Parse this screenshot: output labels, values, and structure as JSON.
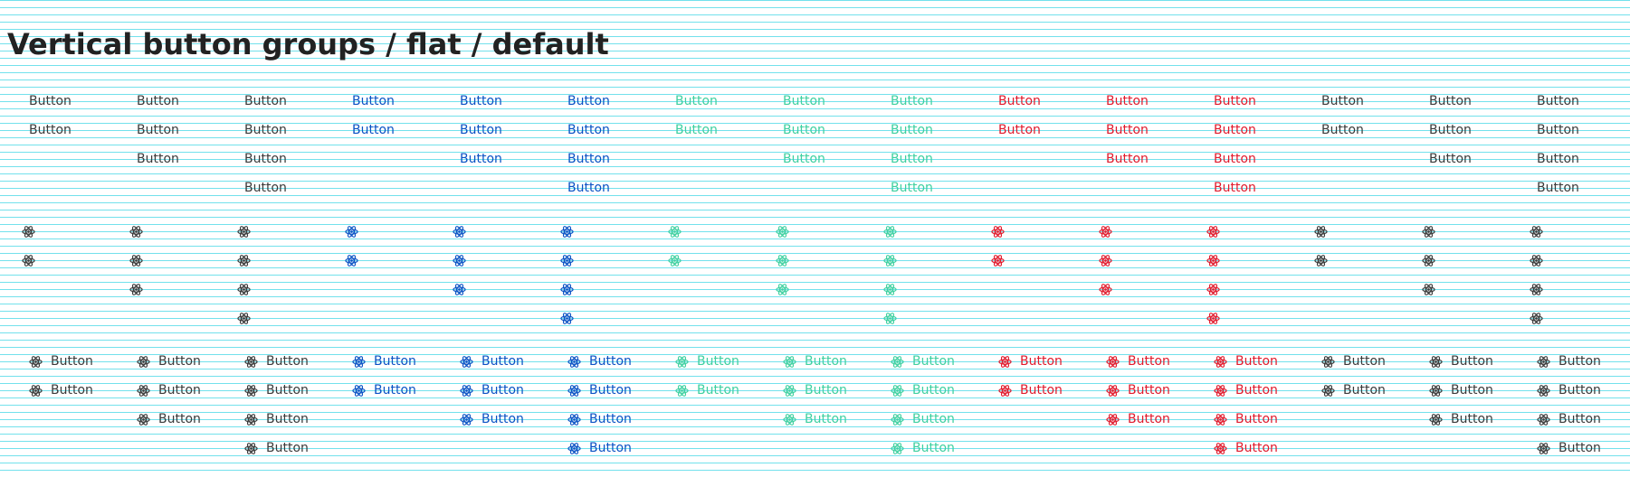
{
  "page": {
    "title": "Vertical button groups / flat / default"
  },
  "button_label": "Button",
  "icon": "atom-icon",
  "colors": {
    "default": "#3a3a3a",
    "primary": "#0a52c4",
    "success": "#3fd0a0",
    "danger": "#e01a2c",
    "neutral": "#3a3a3a"
  },
  "variants": [
    "text-only",
    "icon-only",
    "icon-text"
  ],
  "groups": [
    {
      "color": "default",
      "count": 2
    },
    {
      "color": "default",
      "count": 3
    },
    {
      "color": "default",
      "count": 4
    },
    {
      "color": "primary",
      "count": 2
    },
    {
      "color": "primary",
      "count": 3
    },
    {
      "color": "primary",
      "count": 4
    },
    {
      "color": "success",
      "count": 2
    },
    {
      "color": "success",
      "count": 3
    },
    {
      "color": "success",
      "count": 4
    },
    {
      "color": "danger",
      "count": 2
    },
    {
      "color": "danger",
      "count": 3
    },
    {
      "color": "danger",
      "count": 4
    },
    {
      "color": "neutral",
      "count": 2
    },
    {
      "color": "neutral",
      "count": 3
    },
    {
      "color": "neutral",
      "count": 4
    }
  ]
}
